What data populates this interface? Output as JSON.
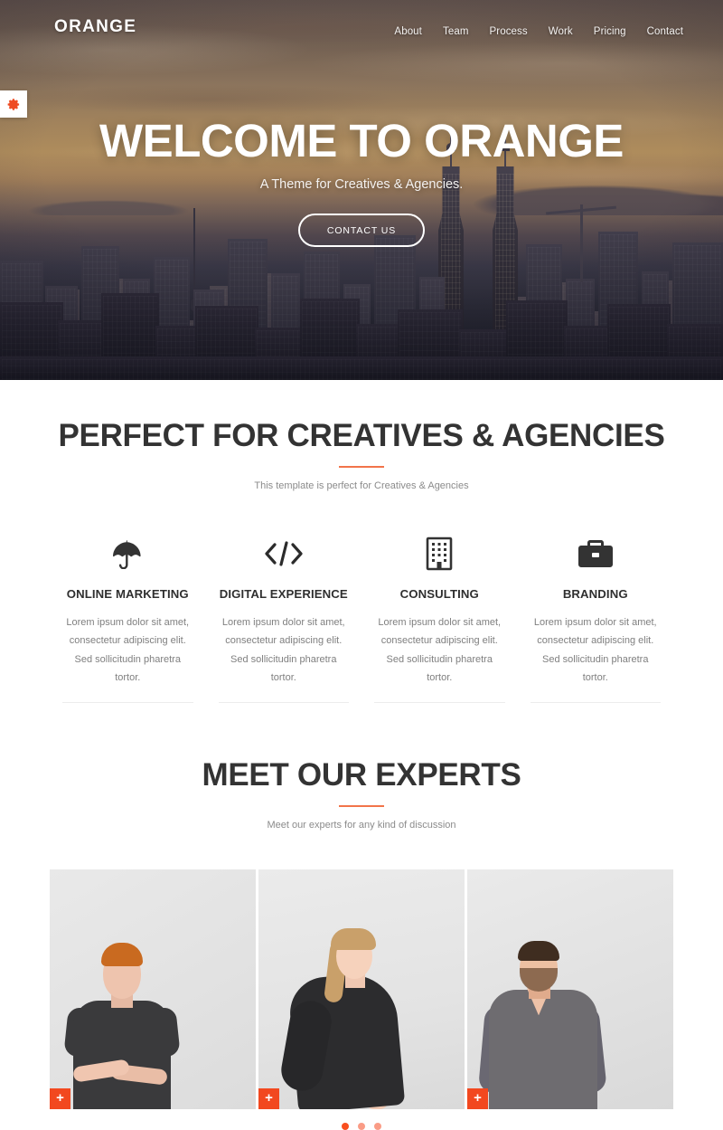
{
  "nav": {
    "logo": "ORANGE",
    "links": [
      {
        "label": "About"
      },
      {
        "label": "Team"
      },
      {
        "label": "Process"
      },
      {
        "label": "Work"
      },
      {
        "label": "Pricing"
      },
      {
        "label": "Contact"
      }
    ]
  },
  "settings_toggle": {
    "icon": "gear-icon",
    "color": "#ee4b22"
  },
  "hero": {
    "title": "WELCOME TO ORANGE",
    "subtitle": "A Theme for Creatives & Agencies.",
    "button_label": "CONTACT US"
  },
  "services_section": {
    "title": "PERFECT FOR CREATIVES & AGENCIES",
    "subtitle": "This template is perfect for Creatives & Agencies",
    "accent_color": "#f2744a",
    "items": [
      {
        "icon": "umbrella-icon",
        "title": "ONLINE MARKETING",
        "text": "Lorem ipsum dolor sit amet, consectetur adipiscing elit. Sed sollicitudin pharetra tortor."
      },
      {
        "icon": "code-icon",
        "title": "DIGITAL EXPERIENCE",
        "text": "Lorem ipsum dolor sit amet, consectetur adipiscing elit. Sed sollicitudin pharetra tortor."
      },
      {
        "icon": "building-icon",
        "title": "CONSULTING",
        "text": "Lorem ipsum dolor sit amet, consectetur adipiscing elit. Sed sollicitudin pharetra tortor."
      },
      {
        "icon": "briefcase-icon",
        "title": "BRANDING",
        "text": "Lorem ipsum dolor sit amet, consectetur adipiscing elit. Sed sollicitudin pharetra tortor."
      }
    ]
  },
  "team_section": {
    "title": "MEET OUR EXPERTS",
    "subtitle": "Meet our experts for any kind of discussion",
    "accent_color": "#f2744a",
    "plus_color": "#f2481f",
    "cards": [
      {
        "plus_label": "+"
      },
      {
        "plus_label": "+"
      },
      {
        "plus_label": "+"
      }
    ],
    "carousel_dots": [
      {
        "active": true
      },
      {
        "active": false
      },
      {
        "active": false
      }
    ]
  }
}
